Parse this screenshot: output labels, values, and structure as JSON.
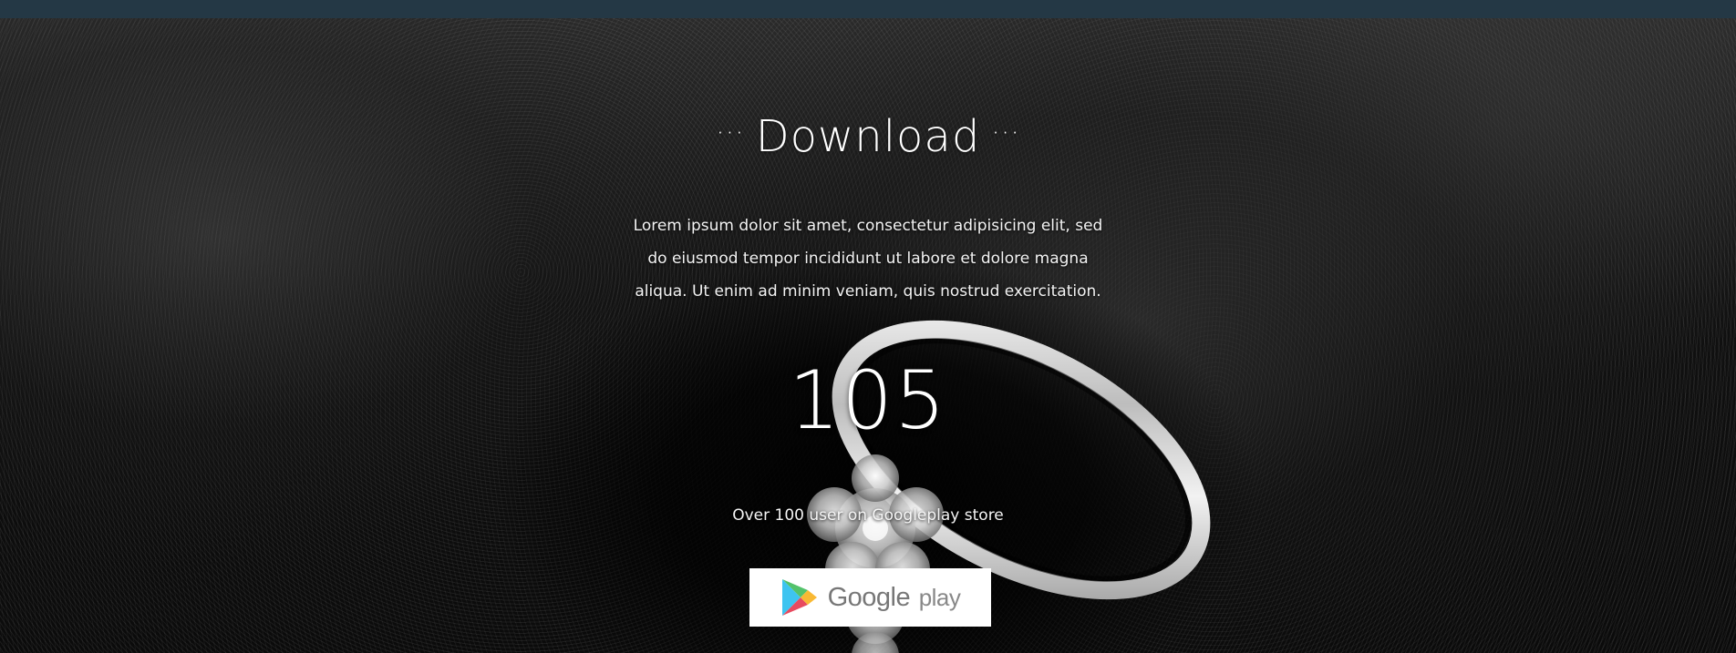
{
  "section": {
    "title": "Download",
    "title_ornament_left": "···",
    "title_ornament_right": "···",
    "description": "Lorem ipsum dolor sit amet, consectetur adipisicing elit, sed do eiusmod tempor incididunt ut labore et dolore magna aliqua. Ut enim ad minim veniam, quis nostrud exercitation.",
    "counter_value": "105",
    "caption": "Over 100 user on Googleplay store"
  },
  "store_badge": {
    "brand": "Google",
    "product": "play",
    "icon": "google-play-triangle-icon"
  },
  "colors": {
    "topbar": "#243845",
    "text": "#ffffff",
    "badge_bg": "#ffffff",
    "badge_text": "#777777"
  }
}
